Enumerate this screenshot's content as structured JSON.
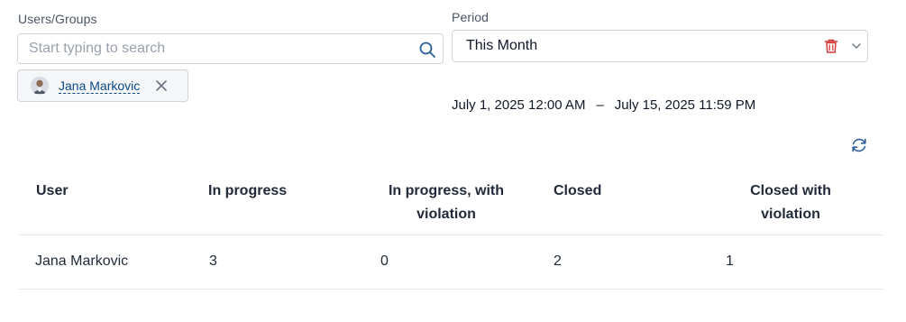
{
  "filters": {
    "users_groups": {
      "label": "Users/Groups",
      "placeholder": "Start typing to search",
      "value": ""
    },
    "period": {
      "label": "Period",
      "selected": "This Month"
    },
    "selected_user": {
      "name": "Jana Markovic"
    },
    "range": {
      "from": "July 1, 2025 12:00 AM",
      "separator": "–",
      "to": "July 15, 2025 11:59 PM"
    }
  },
  "icons": {
    "search": "search-icon",
    "trash": "trash-icon",
    "chevron": "chevron-down-icon",
    "close": "close-icon",
    "refresh": "refresh-icon"
  },
  "colors": {
    "accent": "#0b4a8b",
    "danger": "#d33a3a",
    "border": "#d1d5db",
    "muted": "#6b7280"
  },
  "table": {
    "columns": [
      "User",
      "In progress",
      "In progress, with violation",
      "Closed",
      "Closed with violation"
    ],
    "rows": [
      {
        "user": "Jana Markovic",
        "in_progress": "3",
        "in_progress_violation": "0",
        "closed": "2",
        "closed_violation": "1"
      }
    ]
  }
}
